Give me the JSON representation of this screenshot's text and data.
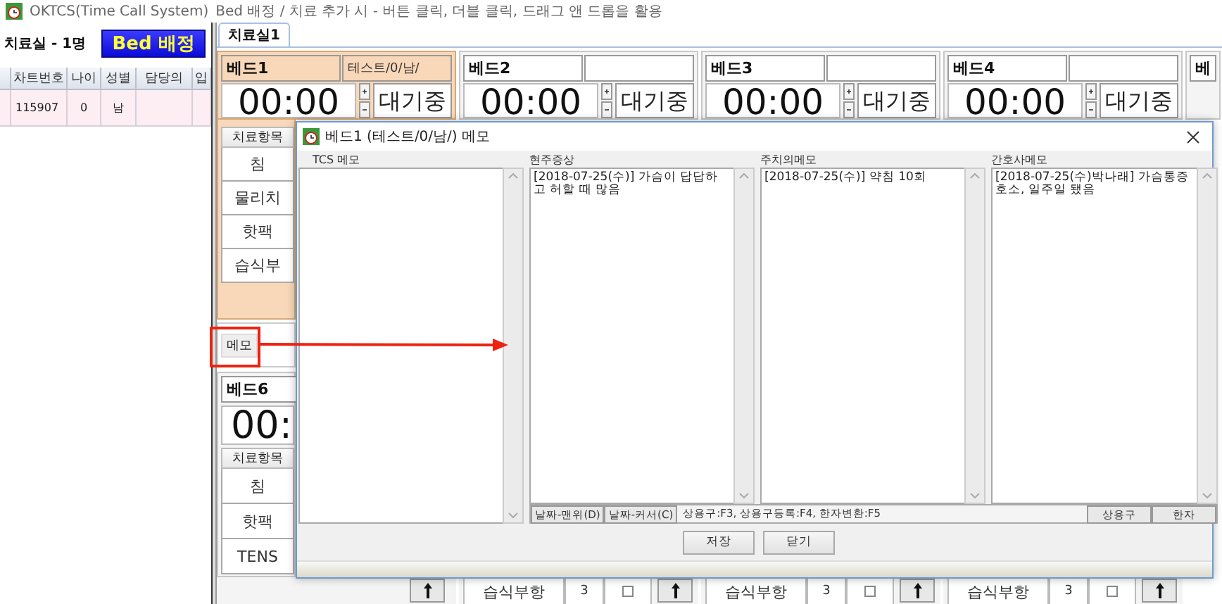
{
  "window": {
    "title": "OKTCS(Time Call System)",
    "subtitle": "Bed 배정 / 치료 추가 시 - 버튼 클릭, 더블 클릭, 드래그 앤 드롭을 활용"
  },
  "left_panel": {
    "heading": "치료실 - 1명",
    "assign_button": "Bed 배정",
    "table": {
      "columns": [
        "차트번호",
        "나이",
        "성별",
        "담당의",
        "입"
      ],
      "rows": [
        {
          "cells": [
            "115907",
            "0",
            "남"
          ],
          "selected": true
        }
      ]
    }
  },
  "tabs": [
    {
      "label": "치료실1",
      "selected": true
    }
  ],
  "beds": [
    {
      "name": "베드1",
      "patient": "테스트/0/남/",
      "timer": "00:00",
      "status": "대기중",
      "selected": true
    },
    {
      "name": "베드2",
      "timer": "00:00",
      "status": "대기중",
      "selected": false
    },
    {
      "name": "베드3",
      "timer": "00:00",
      "status": "대기중",
      "selected": false
    },
    {
      "name": "베드4",
      "timer": "00:00",
      "status": "대기중",
      "selected": false
    },
    {
      "name": "베",
      "selected": false
    }
  ],
  "bed1_items": {
    "header": "치료항목",
    "items": [
      "침",
      "물리치",
      "핫팩",
      "습식부"
    ],
    "memo_button": "메모"
  },
  "bed6": {
    "name": "베드6",
    "timer": "00:",
    "header": "치료항목",
    "items": [
      "침",
      "핫팩",
      "TENS"
    ]
  },
  "bottom_row": [
    {
      "kind": "up"
    },
    {
      "kind": "item",
      "item": "습식부항",
      "count": "3",
      "checked": false
    },
    {
      "kind": "item",
      "item": "습식부항",
      "count": "3",
      "checked": false
    },
    {
      "kind": "item",
      "item": "습식부항",
      "count": "3",
      "checked": false
    }
  ],
  "memo_dialog": {
    "title": "베드1 (테스트/0/남/) 메모",
    "columns": [
      {
        "label": "TCS 메모"
      },
      {
        "label": "현주증상",
        "text": "[2018-07-25(수)] 가슴이 답답하고 허할 때 많음"
      },
      {
        "label": "주치의메모",
        "text": "[2018-07-25(수)] 약침 10회"
      },
      {
        "label": "간호사메모",
        "text": "[2018-07-25(수)박나래] 가슴통증 호소, 일주일 됐음"
      }
    ],
    "left_buttons": [
      "날짜-맨위(D)",
      "날짜-커서(C)"
    ],
    "hint": "상용구:F3, 상용구등록:F4, 한자변환:F5",
    "right_buttons": [
      "상용구",
      "한자"
    ],
    "actions": [
      "저장",
      "닫기"
    ]
  }
}
